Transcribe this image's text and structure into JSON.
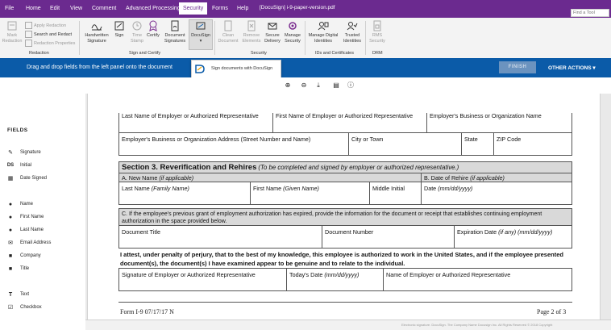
{
  "menu": {
    "items": [
      "File",
      "Home",
      "Edit",
      "View",
      "Comment",
      "Advanced Processing",
      "Security",
      "Forms",
      "Help"
    ],
    "active": "Security",
    "document_title": "[DocuSign] i-9-paper-version.pdf",
    "find_tool_placeholder": "Find a Tool"
  },
  "ribbon": {
    "redaction": {
      "mark_label": "Mark Redaction",
      "apply_label": "Apply Redaction",
      "search_label": "Search and Redact",
      "properties_label": "Redaction Properties",
      "group_label": "Redaction"
    },
    "sign_certify": {
      "handwritten_label": "Handwritten Signature",
      "sign_label": "Sign",
      "time_stamp_label": "Time Stamp",
      "certify_label": "Certify",
      "document_signatures_label": "Document Signatures",
      "docusign_label": "DocuSign",
      "group_label": "Sign and Certify"
    },
    "security": {
      "clean_label": "Clean Document",
      "remove_label": "Remove Elements",
      "secure_label": "Secure Delivery",
      "manage_label": "Manage Security",
      "group_label": "Security"
    },
    "ids": {
      "manage_digital_label": "Manage Digital Identities",
      "trusted_label": "Trusted Identities",
      "group_label": "IDs and Certificates"
    },
    "drm": {
      "rms_label": "RMS Security",
      "group_label": "DRM"
    }
  },
  "action_bar": {
    "hint": "Drag and drop fields from the left panel onto the document",
    "finish_label": "FINISH",
    "other_actions_label": "OTHER ACTIONS ▾"
  },
  "docusign_popup": {
    "text": "Sign documents with DocuSign"
  },
  "fields_panel": {
    "title": "FIELDS",
    "items": [
      {
        "label": "Signature",
        "icon": "pen-icon"
      },
      {
        "label": "Initial",
        "icon": "ds-initial-icon"
      },
      {
        "label": "Date Signed",
        "icon": "calendar-icon"
      },
      {
        "label": "Name",
        "icon": "person-icon"
      },
      {
        "label": "First Name",
        "icon": "person-icon"
      },
      {
        "label": "Last Name",
        "icon": "person-icon"
      },
      {
        "label": "Email Address",
        "icon": "envelope-icon"
      },
      {
        "label": "Company",
        "icon": "briefcase-icon"
      },
      {
        "label": "Title",
        "icon": "briefcase-icon"
      },
      {
        "label": "Text",
        "icon": "text-icon"
      },
      {
        "label": "Checkbox",
        "icon": "checkbox-icon"
      }
    ]
  },
  "form": {
    "top_row": {
      "c1": "Last Name of Employer or Authorized Representative",
      "c2": "First Name of Employer or Authorized Representative",
      "c3": "Employer's Business or Organization Name"
    },
    "address_row": {
      "address": "Employer's Business or Organization Address (Street Number and Name)",
      "city": "City or Town",
      "state": "State",
      "zip": "ZIP Code"
    },
    "section3": {
      "title": "Section 3. Reverification and Rehires",
      "subtitle": "(To be completed and signed by employer or authorized representative.)",
      "a_label": "A. New Name",
      "a_note": "(if applicable)",
      "b_label": "B. Date of Rehire",
      "b_note": "(if applicable)",
      "last_name": "Last Name",
      "last_name_note": "(Family Name)",
      "first_name": "First Name",
      "first_name_note": "(Given Name)",
      "middle_initial": "Middle Initial",
      "date": "Date",
      "date_note": "(mm/dd/yyyy)",
      "c_text": "C. If the employee's previous grant of employment authorization has expired, provide the information for the document or receipt that establishes continuing employment authorization in the space provided below.",
      "doc_title": "Document Title",
      "doc_number": "Document Number",
      "expiration": "Expiration Date",
      "expiration_note": "(if any) (mm/dd/yyyy)",
      "attest": "I attest, under penalty of perjury, that to the best of my knowledge, this employee is authorized to work in the United States, and if the employee presented document(s), the document(s) I have examined appear to be genuine and to relate to the individual.",
      "sig_employer": "Signature of Employer or Authorized Representative",
      "todays_date": "Today's Date",
      "todays_date_note": "(mm/dd/yyyy)",
      "name_employer": "Name of Employer or Authorized Representative"
    },
    "footer_form": "Form I-9  07/17/17  N",
    "footer_page": "Page 2 of 3"
  },
  "status_bar": {
    "text": "Electronic signature. DocuSign. The Company Name Docusign Inc. All Rights Reserved © 2018 Copyright"
  },
  "colors": {
    "menu_bg": "#6b2a8f",
    "action_bar_bg": "#0b5ba8",
    "finish_bg": "#6b93bf"
  }
}
